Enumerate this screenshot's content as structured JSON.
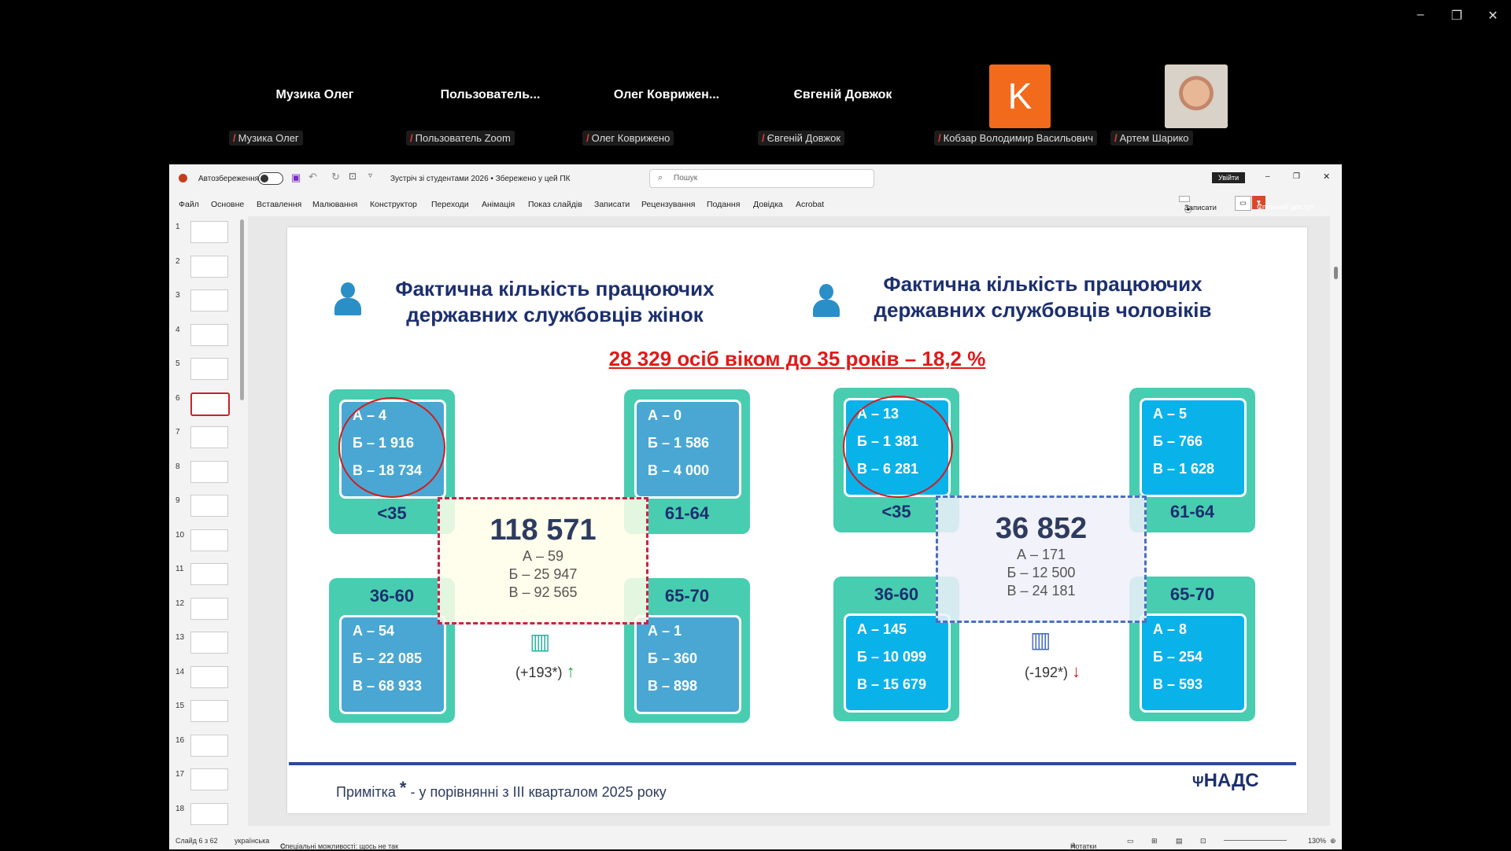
{
  "window_controls": {
    "minimize": "–",
    "restore": "❐",
    "close": "✕"
  },
  "participants": {
    "video_names": [
      "Музика Олег",
      "Пользователь...",
      "Олег  Коврижен...",
      "Євгеній Довжок"
    ],
    "avatar_letter": "K",
    "labels": [
      "Музика Олег",
      "Пользователь Zoom",
      "Олег Коврижено",
      "Євгеній Довжок",
      "Кобзар Володимир Васильович",
      "Артем Шарико"
    ]
  },
  "ppt": {
    "autosave_label": "Автозбереження",
    "doc_title": "Зустріч зі студентами 2026 • Збережено у цей ПК",
    "search_placeholder": "Пошук",
    "signin_label": "Увійти",
    "menu": [
      "Файл",
      "Основне",
      "Вставлення",
      "Малювання",
      "Конструктор",
      "Переходи",
      "Анімація",
      "Показ слайдів",
      "Записати",
      "Рецензування",
      "Подання",
      "Довідка",
      "Acrobat"
    ],
    "record_label": "Записати",
    "share_label": "Спільний доступ",
    "thumb_numbers": [
      "1",
      "2",
      "3",
      "4",
      "5",
      "6",
      "7",
      "8",
      "9",
      "10",
      "11",
      "12",
      "13",
      "14",
      "15",
      "16",
      "17",
      "18"
    ],
    "selected_thumb": "6",
    "status": {
      "slide_info": "Слайд 6 з 62",
      "language": "українська",
      "accessibility": "Спеціальні можливості: щось не так",
      "notes": "Нотатки",
      "zoom": "130%"
    }
  },
  "slide": {
    "title_women": "Фактична кількість працюючих\nдержавних службовців жінок",
    "title_men": "Фактична кількість працюючих\nдержавних службовців чоловіків",
    "subtitle": "28 329 осіб віком до 35 років – 18,2 %",
    "women": {
      "under35": {
        "a": "А – 4",
        "b": "Б – 1 916",
        "v": "В – 18 734",
        "age": "<35"
      },
      "age61_64": {
        "a": "А – 0",
        "b": "Б – 1 586",
        "v": "В – 4 000",
        "age": "61-64"
      },
      "age36_60": {
        "a": "А – 54",
        "b": "Б – 22 085",
        "v": "В – 68 933",
        "age": "36-60"
      },
      "age65_70": {
        "a": "А – 1",
        "b": "Б – 360",
        "v": "В – 898",
        "age": "65-70"
      },
      "total": "118 571",
      "total_a": "А – 59",
      "total_b": "Б – 25 947",
      "total_v": "В – 92 565",
      "change": "(+193*)"
    },
    "men": {
      "under35": {
        "a": "А – 13",
        "b": "Б – 1 381",
        "v": "В – 6 281",
        "age": "<35"
      },
      "age61_64": {
        "a": "А – 5",
        "b": "Б – 766",
        "v": "В – 1 628",
        "age": "61-64"
      },
      "age36_60": {
        "a": "А – 145",
        "b": "Б – 10 099",
        "v": "В – 15 679",
        "age": "36-60"
      },
      "age65_70": {
        "a": "А – 8",
        "b": "Б – 254",
        "v": "В – 593",
        "age": "65-70"
      },
      "total": "36 852",
      "total_a": "А – 171",
      "total_b": "Б – 12 500",
      "total_v": "В – 24 181",
      "change": "(-192*)"
    },
    "note_prefix": "Примітка",
    "note_star": "*",
    "note_text": " - у порівнянні з ІІІ кварталом 2025 року",
    "logo_text": "НАДС",
    "colors": {
      "title": "#1c2f6e",
      "highlight": "#e01a1a",
      "card": "#48cdb1",
      "up": "#1aa64a",
      "down": "#d11d1d"
    }
  }
}
